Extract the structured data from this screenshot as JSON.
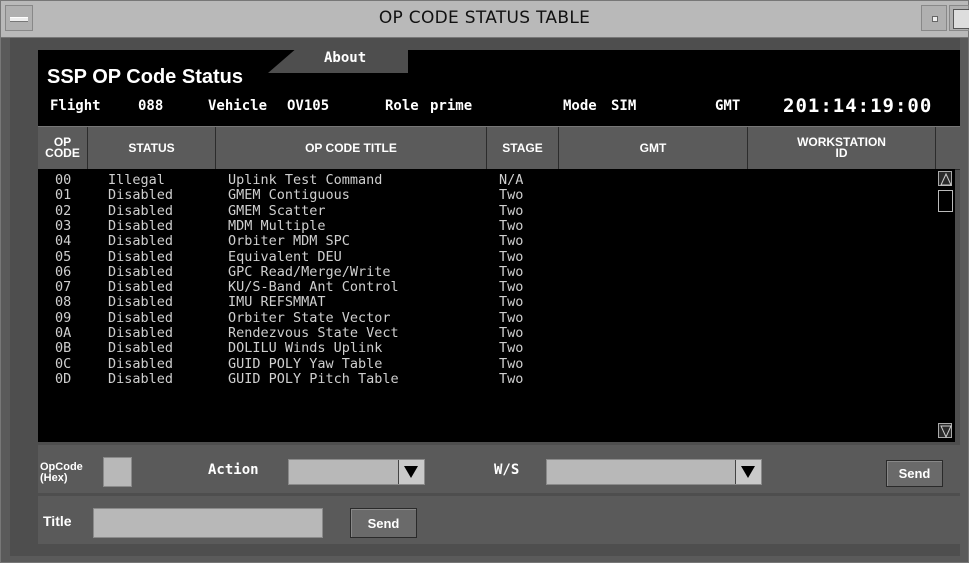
{
  "window": {
    "title": "OP CODE STATUS TABLE"
  },
  "header": {
    "heading": "SSP OP Code Status",
    "about_label": "About",
    "flight_label": "Flight",
    "flight_value": "088",
    "vehicle_label": "Vehicle",
    "vehicle_value": "OV105",
    "role_label": "Role",
    "role_value": "prime",
    "mode_label": "Mode",
    "mode_value": "SIM",
    "gmt_label": "GMT",
    "gmt_value": "201:14:19:00"
  },
  "columns": {
    "op_code": [
      "OP",
      "CODE"
    ],
    "status": "STATUS",
    "title": "OP CODE TITLE",
    "stage": "STAGE",
    "gmt": "GMT",
    "workstation": [
      "WORKSTATION",
      "ID"
    ]
  },
  "rows": [
    {
      "code": "00",
      "status": "Illegal",
      "title": "Uplink Test Command",
      "stage": "N/A"
    },
    {
      "code": "01",
      "status": "Disabled",
      "title": "GMEM Contiguous",
      "stage": "Two"
    },
    {
      "code": "02",
      "status": "Disabled",
      "title": "GMEM Scatter",
      "stage": "Two"
    },
    {
      "code": "03",
      "status": "Disabled",
      "title": "MDM Multiple",
      "stage": "Two"
    },
    {
      "code": "04",
      "status": "Disabled",
      "title": "Orbiter MDM SPC",
      "stage": "Two"
    },
    {
      "code": "05",
      "status": "Disabled",
      "title": "Equivalent DEU",
      "stage": "Two"
    },
    {
      "code": "06",
      "status": "Disabled",
      "title": "GPC Read/Merge/Write",
      "stage": "Two"
    },
    {
      "code": "07",
      "status": "Disabled",
      "title": "KU/S-Band Ant Control",
      "stage": "Two"
    },
    {
      "code": "08",
      "status": "Disabled",
      "title": "IMU REFSMMAT",
      "stage": "Two"
    },
    {
      "code": "09",
      "status": "Disabled",
      "title": "Orbiter State Vector",
      "stage": "Two"
    },
    {
      "code": "0A",
      "status": "Disabled",
      "title": "Rendezvous State Vect",
      "stage": "Two"
    },
    {
      "code": "0B",
      "status": "Disabled",
      "title": "DOLILU Winds Uplink",
      "stage": "Two"
    },
    {
      "code": "0C",
      "status": "Disabled",
      "title": "GUID POLY Yaw Table",
      "stage": "Two"
    },
    {
      "code": "0D",
      "status": "Disabled",
      "title": "GUID POLY Pitch Table",
      "stage": "Two"
    }
  ],
  "controls": {
    "opcode_label": [
      "OpCode",
      "(Hex)"
    ],
    "opcode_value": "",
    "action_label": "Action",
    "action_value": "",
    "ws_label": "W/S",
    "ws_value": "",
    "send_label": "Send",
    "title_label": "Title",
    "title_value": "",
    "title_send_label": "Send"
  },
  "icons": {
    "window_menu": "window-menu-icon",
    "minimize": "minimize-icon",
    "maximize": "maximize-icon",
    "scroll_up": "arrow-up-icon",
    "scroll_down": "arrow-down-icon",
    "dropdown": "triangle-down-icon"
  }
}
